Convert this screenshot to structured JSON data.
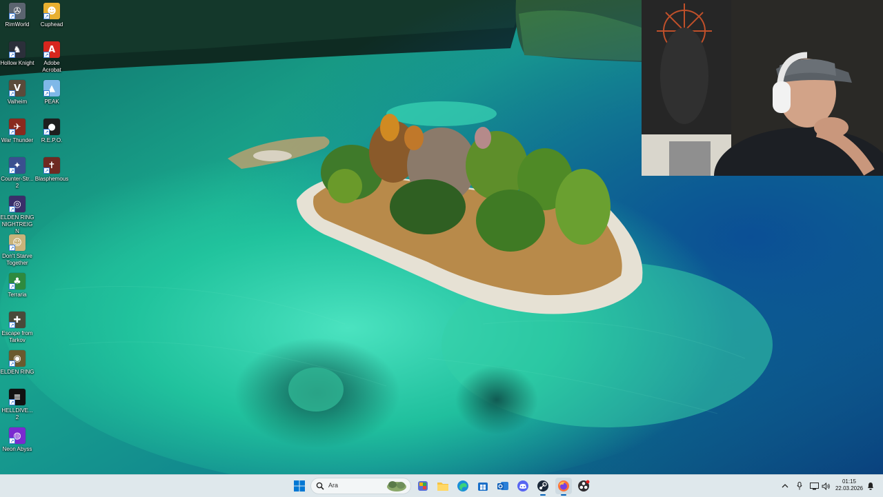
{
  "desktop": {
    "icons": [
      {
        "label": "RimWorld",
        "icon": "rimworld-icon",
        "color": "#5b6470"
      },
      {
        "label": "Cuphead",
        "icon": "cuphead-icon",
        "color": "#e8b030"
      },
      {
        "label": "Hollow Knight",
        "icon": "hollow-knight-icon",
        "color": "#2b2f3a"
      },
      {
        "label": "Adobe Acrobat",
        "icon": "adobe-acrobat-icon",
        "color": "#d7261e"
      },
      {
        "label": "Valheim",
        "icon": "valheim-icon",
        "color": "#5b4a3a"
      },
      {
        "label": "PEAK",
        "icon": "peak-icon",
        "color": "#7fb8e8"
      },
      {
        "label": "War Thunder",
        "icon": "war-thunder-icon",
        "color": "#8a2a1e"
      },
      {
        "label": "R.E.P.O.",
        "icon": "repo-icon",
        "color": "#1e1e1e"
      },
      {
        "label": "Counter-Str... 2",
        "icon": "counter-strike-icon",
        "color": "#3a4f8f"
      },
      {
        "label": "Blasphemous",
        "icon": "blasphemous-icon",
        "color": "#6e2a22"
      },
      {
        "label": "ELDEN RING NIGHTREIGN",
        "icon": "elden-ring-nightreign-icon",
        "color": "#3a2e6a"
      },
      {
        "label": "Don't Starve Together",
        "icon": "dont-starve-together-icon",
        "color": "#c9b37a"
      },
      {
        "label": "Terraria",
        "icon": "terraria-icon",
        "color": "#2e8a3e"
      },
      {
        "label": "Escape from Tarkov",
        "icon": "escape-from-tarkov-icon",
        "color": "#4a4a3a"
      },
      {
        "label": "ELDEN RING",
        "icon": "elden-ring-icon",
        "color": "#6a5a2e"
      },
      {
        "label": "HELLDIVE... 2",
        "icon": "helldivers-2-icon",
        "color": "#111111"
      },
      {
        "label": "Neon Abyss",
        "icon": "neon-abyss-icon",
        "color": "#7a2ad0"
      }
    ]
  },
  "taskbar": {
    "search_placeholder": "Ara",
    "apps": [
      {
        "icon": "start-windows-icon"
      },
      {
        "icon": "search-icon"
      },
      {
        "icon": "widgets-icon"
      },
      {
        "icon": "office-store-icon"
      },
      {
        "icon": "file-explorer-icon"
      },
      {
        "icon": "edge-icon"
      },
      {
        "icon": "microsoft-store-icon"
      },
      {
        "icon": "outlook-icon"
      },
      {
        "icon": "discord-icon"
      },
      {
        "icon": "steam-icon"
      },
      {
        "icon": "firefox-icon"
      },
      {
        "icon": "obs-icon"
      }
    ],
    "tray": {
      "chevron": "show-hidden-icons",
      "mic": "microphone-icon",
      "network": "network-icon",
      "volume": "volume-icon",
      "notification": "notification-icon"
    },
    "time": "01:15",
    "date": "22.03.2026"
  },
  "colors": {
    "taskbar_bg": "#dfe8ec",
    "accent": "#005fb8",
    "water_shallow": "#2fd3b0",
    "water_deep": "#0a4f8a"
  }
}
